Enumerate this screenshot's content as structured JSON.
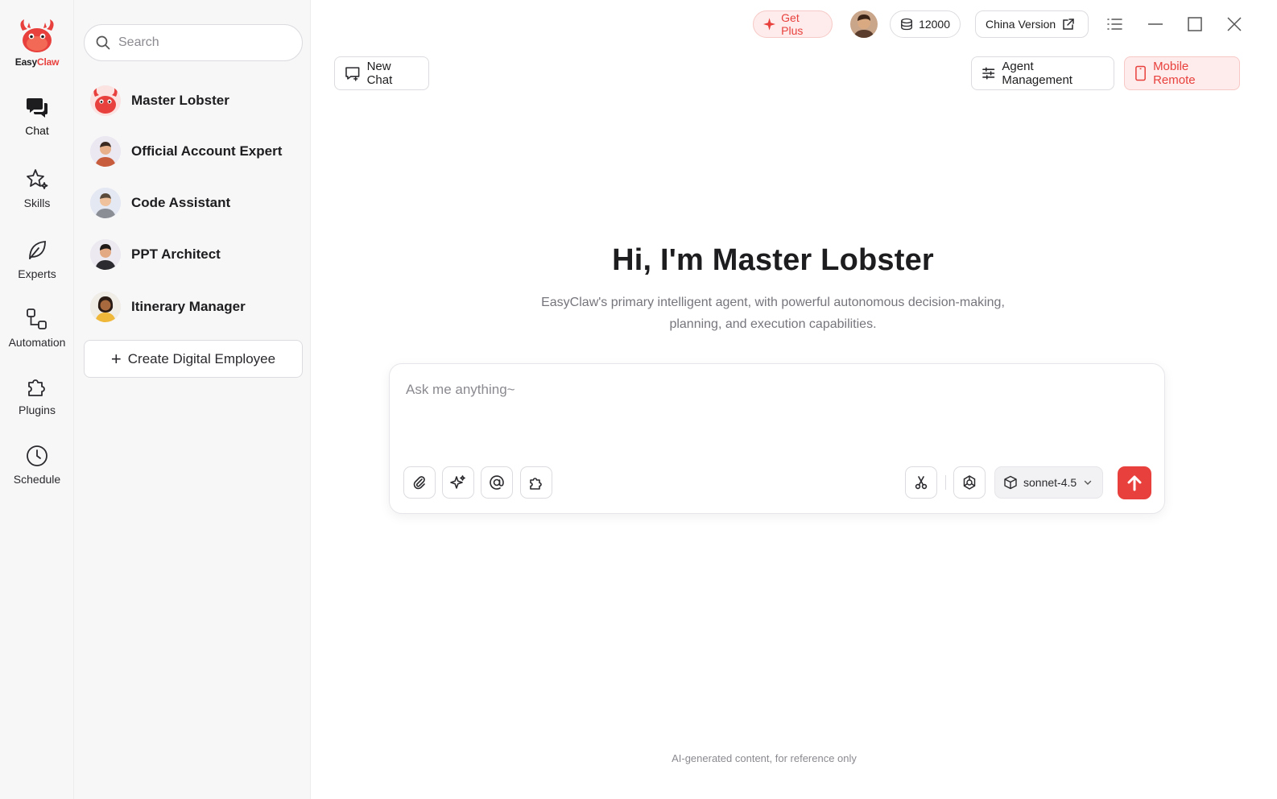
{
  "brand": {
    "name_part1": "Easy",
    "name_part2": "Claw",
    "accent": "#e8403c"
  },
  "nav": {
    "items": [
      {
        "label": "Chat",
        "icon": "chat-bubbles-icon",
        "active": true
      },
      {
        "label": "Skills",
        "icon": "sparkle-star-icon",
        "active": false
      },
      {
        "label": "Experts",
        "icon": "leaf-icon",
        "active": false
      },
      {
        "label": "Automation",
        "icon": "workflow-icon",
        "active": false
      },
      {
        "label": "Plugins",
        "icon": "puzzle-icon",
        "active": false
      },
      {
        "label": "Schedule",
        "icon": "clock-icon",
        "active": false
      }
    ]
  },
  "agents": {
    "search_placeholder": "Search",
    "items": [
      {
        "name": "Master Lobster",
        "avatar": "lobster-avatar"
      },
      {
        "name": "Official Account Expert",
        "avatar": "person-avatar"
      },
      {
        "name": "Code Assistant",
        "avatar": "person-avatar"
      },
      {
        "name": "PPT Architect",
        "avatar": "person-avatar"
      },
      {
        "name": "Itinerary Manager",
        "avatar": "person-avatar"
      }
    ],
    "create_label": "Create Digital Employee"
  },
  "topbar": {
    "get_plus": "Get Plus",
    "credits": "12000",
    "china_version": "China Version"
  },
  "toolbar": {
    "new_chat": "New Chat",
    "agent_management": "Agent Management",
    "mobile_remote": "Mobile Remote"
  },
  "hero": {
    "title": "Hi, I'm Master Lobster",
    "subtitle": "EasyClaw's primary intelligent agent, with powerful autonomous decision-making, planning, and execution capabilities."
  },
  "composer": {
    "placeholder": "Ask me anything~",
    "model": "sonnet-4.5"
  },
  "footer": {
    "note": "AI-generated content, for reference only"
  }
}
